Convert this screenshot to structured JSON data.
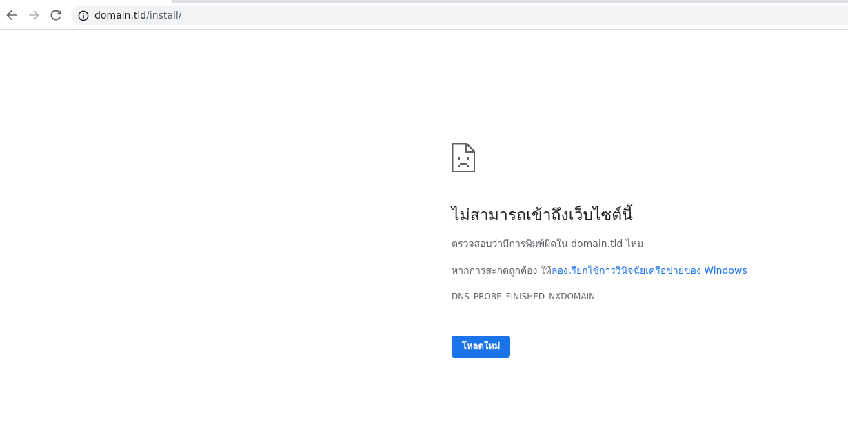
{
  "browser": {
    "url_host": "domain.tld",
    "url_path": "/install/",
    "icons": {
      "back": "back-arrow-icon",
      "forward": "forward-arrow-icon",
      "reload": "reload-icon",
      "site_info": "info-icon"
    }
  },
  "error_page": {
    "icon": "sad-page-icon",
    "headline": "ไม่สามารถเข้าถึงเว็บไซต์นี้",
    "suggestion_1_prefix": "ตรวจสอบว่ามีการพิมพ์ผิดใน",
    "suggestion_1_domain": "domain.tld",
    "suggestion_1_suffix": "ไหม",
    "suggestion_2_prefix": "หากการสะกดถูกต้อง ให้",
    "suggestion_2_link": "ลองเรียกใช้การวินิจฉัยเครือข่ายของ Windows",
    "error_code": "DNS_PROBE_FINISHED_NXDOMAIN",
    "reload_label": "โหลดใหม่"
  },
  "colors": {
    "accent": "#1a73e8",
    "text_primary": "#202124",
    "text_secondary": "#5f6368",
    "omnibox_bg": "#f1f3f4"
  }
}
